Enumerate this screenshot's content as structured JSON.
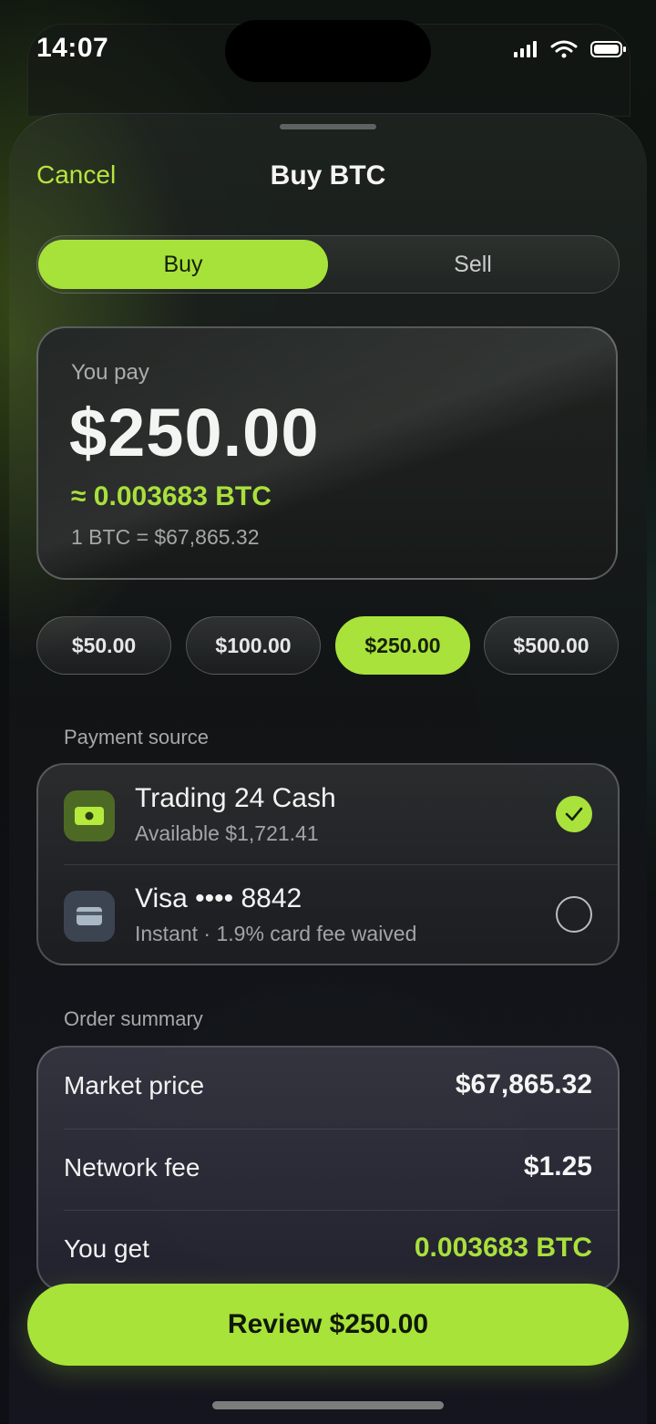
{
  "status_bar": {
    "time": "14:07"
  },
  "header": {
    "cancel_label": "Cancel",
    "title": "Buy BTC"
  },
  "segment": {
    "buy_label": "Buy",
    "sell_label": "Sell",
    "selected": "Buy"
  },
  "pay": {
    "label": "You pay",
    "amount": "$250.00",
    "btc_equivalent": "≈ 0.003683 BTC",
    "rate": "1 BTC = $67,865.32"
  },
  "quick_amounts": [
    {
      "label": "$50.00",
      "selected": false
    },
    {
      "label": "$100.00",
      "selected": false
    },
    {
      "label": "$250.00",
      "selected": true
    },
    {
      "label": "$500.00",
      "selected": false
    }
  ],
  "payment_source": {
    "section_label": "Payment source",
    "options": [
      {
        "name": "Trading 24 Cash",
        "subtitle": "Available $1,721.41",
        "icon": "cash-icon",
        "selected": true
      },
      {
        "name": "Visa •••• 8842",
        "subtitle": "Instant · 1.9% card fee waived",
        "icon": "card-icon",
        "selected": false
      }
    ]
  },
  "order_summary": {
    "section_label": "Order summary",
    "rows": [
      {
        "label": "Market price",
        "value": "$67,865.32"
      },
      {
        "label": "Network fee",
        "value": "$1.25"
      },
      {
        "label": "You get",
        "value": "0.003683 BTC"
      }
    ]
  },
  "cta": {
    "label": "Review $250.00"
  },
  "colors": {
    "accent": "#a9e23b",
    "background": "#0b0d10"
  }
}
